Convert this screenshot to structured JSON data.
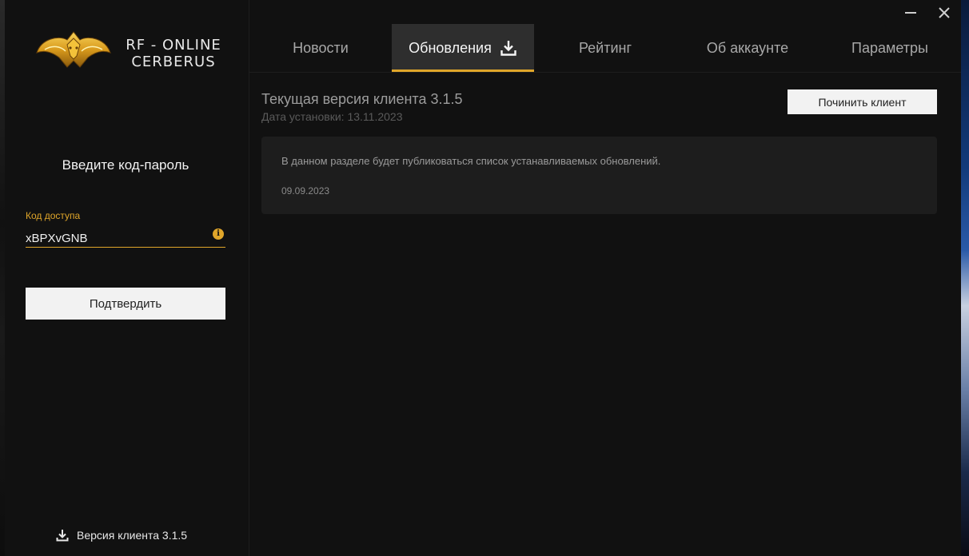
{
  "app": {
    "brand_line1": "RF - ONLINE",
    "brand_line2": "CERBERUS"
  },
  "sidebar": {
    "prompt_title": "Введите код-пароль",
    "access_label": "Код доступа",
    "access_value": "xBPXvGNB",
    "info_glyph": "i",
    "confirm_label": "Подтвердить",
    "version_footer": "Версия клиента 3.1.5"
  },
  "tabs": [
    {
      "label": "Новости",
      "active": false
    },
    {
      "label": "Обновления",
      "active": true,
      "icon": "download-icon"
    },
    {
      "label": "Рейтинг",
      "active": false
    },
    {
      "label": "Об аккаунте",
      "active": false
    },
    {
      "label": "Параметры",
      "active": false
    }
  ],
  "main": {
    "current_version": "Текущая версия клиента 3.1.5",
    "install_date": "Дата установки: 13.11.2023",
    "repair_label": "Починить клиент",
    "news": {
      "text": "В данном разделе будет публиковаться список устанавливаемых обновлений.",
      "date": "09.09.2023"
    }
  },
  "colors": {
    "accent": "#e0a62a",
    "background": "#111111",
    "card": "#1d1d1d",
    "active_tab": "#2e2e2e"
  }
}
